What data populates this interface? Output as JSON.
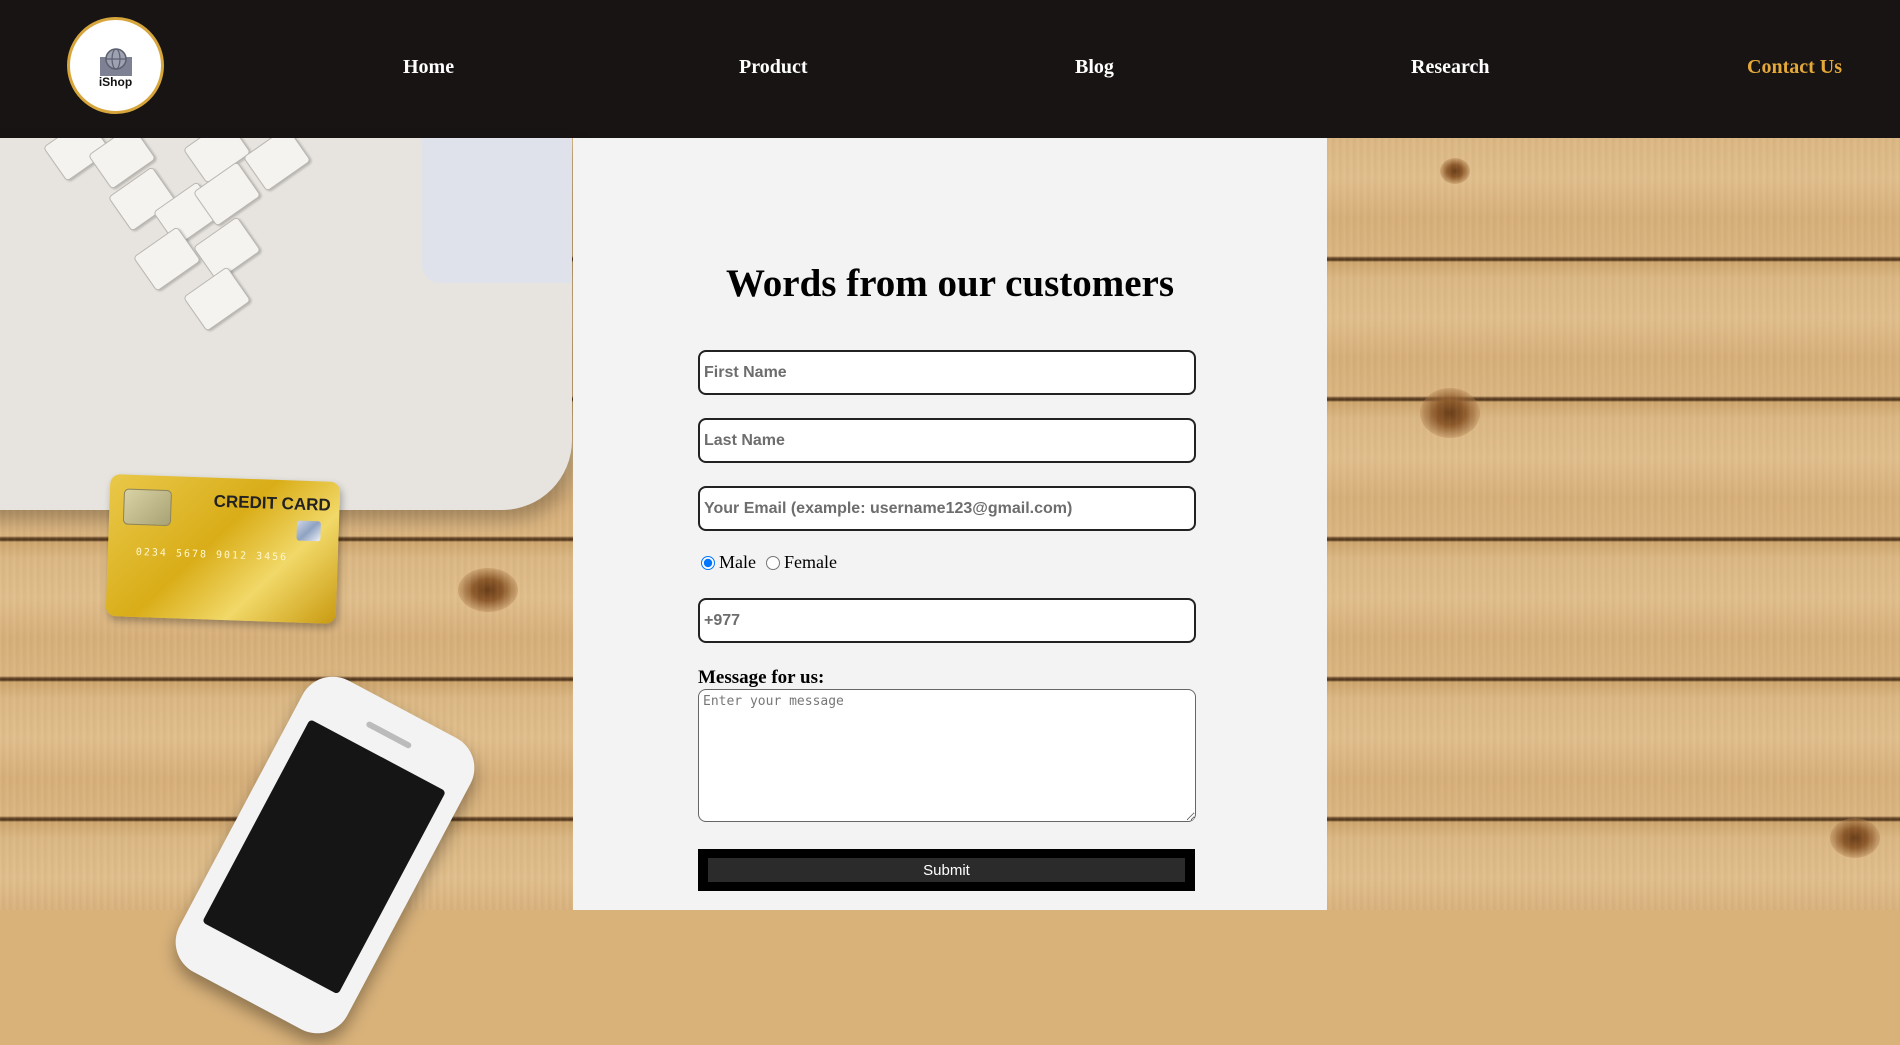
{
  "nav": {
    "logo_text": "iShop",
    "links": [
      {
        "label": "Home"
      },
      {
        "label": "Product"
      },
      {
        "label": "Blog"
      },
      {
        "label": "Research"
      },
      {
        "label": "Contact Us",
        "active": true
      }
    ],
    "accent_color": "#e5a93a",
    "background_color": "#181413"
  },
  "background_image": {
    "card_text": "CREDIT CARD",
    "card_number": "0234  5678  9012  3456"
  },
  "form": {
    "heading": "Words from our customers",
    "first_name_placeholder": "First Name",
    "last_name_placeholder": "Last Name",
    "email_placeholder": "Your Email (example: username123@gmail.com)",
    "gender_options": [
      {
        "label": "Male",
        "selected": true
      },
      {
        "label": "Female",
        "selected": false
      }
    ],
    "phone_placeholder": "+977",
    "message_label": "Message for us:",
    "message_placeholder": "Enter your message",
    "submit_label": "Submit"
  }
}
